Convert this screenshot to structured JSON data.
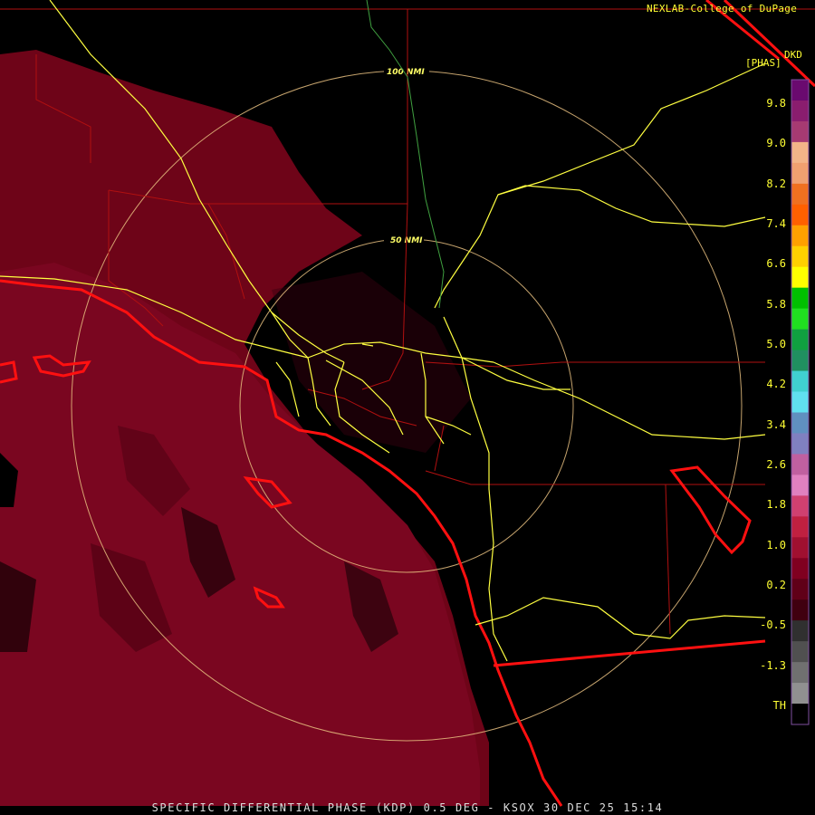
{
  "header": {
    "credit": "NEXLAB-College of DuPage",
    "product_code": "DKD",
    "units": "[PHAS]"
  },
  "rings": {
    "inner_label": "50 NMI",
    "outer_label": "100 NMI"
  },
  "color_scale": {
    "labels": [
      "9.8",
      "9.0",
      "8.2",
      "7.4",
      "6.6",
      "5.8",
      "5.0",
      "4.2",
      "3.4",
      "2.6",
      "1.8",
      "1.0",
      "0.2",
      "-0.5",
      "-1.3",
      "TH"
    ],
    "colors": [
      "#6a0a6f",
      "#8a1d6e",
      "#a63a72",
      "#f2b488",
      "#f0a070",
      "#f07020",
      "#ff6000",
      "#ffa000",
      "#ffd000",
      "#ffff00",
      "#00c000",
      "#20e020",
      "#10a040",
      "#209060",
      "#40d0d0",
      "#60e0f0",
      "#6090c0",
      "#8080c0",
      "#c060a0",
      "#e080c0",
      "#d04070",
      "#c02040",
      "#a01030",
      "#800020",
      "#600018",
      "#400010",
      "#303030",
      "#505050",
      "#707070",
      "#909090",
      "#000000"
    ]
  },
  "footer": {
    "title": "SPECIFIC DIFFERENTIAL PHASE (KDP) 0.5 DEG - KSOX 30 DEC 25 15:14"
  }
}
